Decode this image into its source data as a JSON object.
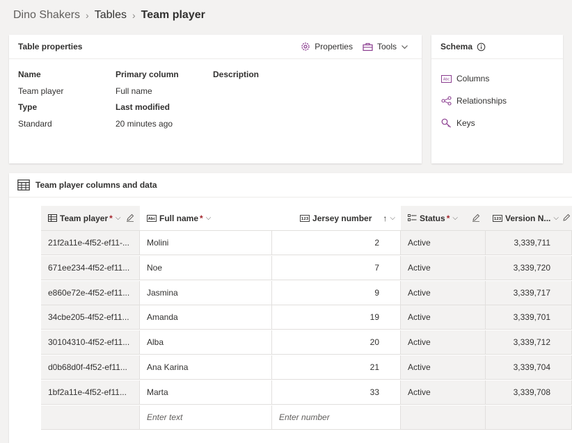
{
  "breadcrumb": {
    "root": "Dino Shakers",
    "section": "Tables",
    "current": "Team player"
  },
  "properties_card": {
    "title": "Table properties",
    "properties_button": "Properties",
    "tools_button": "Tools",
    "labels": {
      "name": "Name",
      "primary_column": "Primary column",
      "description": "Description",
      "type": "Type",
      "last_modified": "Last modified"
    },
    "values": {
      "name": "Team player",
      "primary_column": "Full name",
      "type": "Standard",
      "last_modified": "20 minutes ago"
    }
  },
  "schema_card": {
    "title": "Schema",
    "items": [
      {
        "label": "Columns",
        "icon": "columns-icon"
      },
      {
        "label": "Relationships",
        "icon": "relationships-icon"
      },
      {
        "label": "Keys",
        "icon": "keys-icon"
      }
    ]
  },
  "data_section": {
    "title": "Team player columns and data",
    "columns": [
      {
        "label": "Team player",
        "required": "*"
      },
      {
        "label": "Full name",
        "required": "*"
      },
      {
        "label": "Jersey number",
        "sort": "↑"
      },
      {
        "label": "Status",
        "required": "*"
      },
      {
        "label": "Version N..."
      }
    ],
    "rows": [
      [
        "21f2a11e-4f52-ef11-...",
        "Molini",
        "2",
        "Active",
        "3,339,711"
      ],
      [
        "671ee234-4f52-ef11...",
        "Noe",
        "7",
        "Active",
        "3,339,720"
      ],
      [
        "e860e72e-4f52-ef11...",
        "Jasmina",
        "9",
        "Active",
        "3,339,717"
      ],
      [
        "34cbe205-4f52-ef11...",
        "Amanda",
        "19",
        "Active",
        "3,339,701"
      ],
      [
        "30104310-4f52-ef11...",
        "Alba",
        "20",
        "Active",
        "3,339,712"
      ],
      [
        "d0b68d0f-4f52-ef11...",
        "Ana Karina",
        "21",
        "Active",
        "3,339,704"
      ],
      [
        "1bf2a11e-4f52-ef11...",
        "Marta",
        "33",
        "Active",
        "3,339,708"
      ]
    ],
    "new_row": {
      "text_placeholder": "Enter text",
      "number_placeholder": "Enter number"
    }
  },
  "colors": {
    "accent": "#8a3c8f",
    "required": "#a4262c"
  }
}
